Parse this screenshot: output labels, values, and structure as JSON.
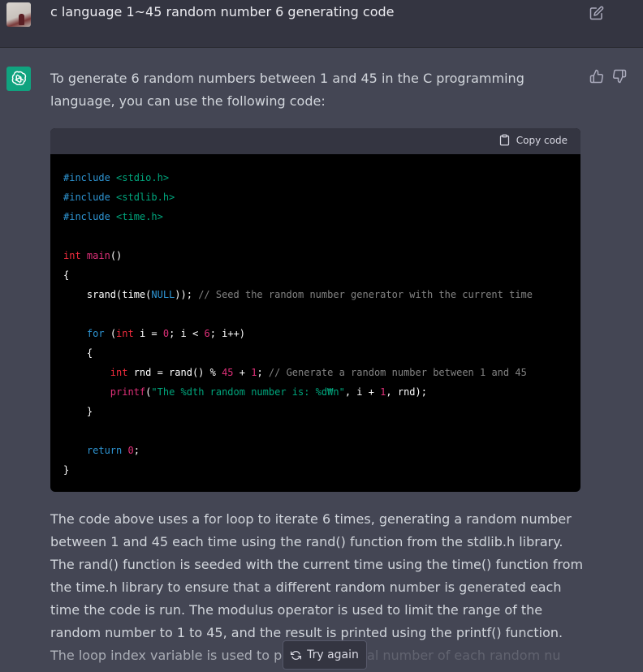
{
  "user_message": {
    "text": "c language 1~45 random number 6 generating code"
  },
  "assistant_message": {
    "intro": "To generate 6 random numbers between 1 and 45 in the C programming language, you can use the following code:",
    "copy_label": "Copy code",
    "outro": "The code above uses a for loop to iterate 6 times, generating a random number between 1 and 45 each time using the rand() function from the stdlib.h library. The rand() function is seeded with the current time using the time() function from the time.h library to ensure that a different random number is generated each time the code is run. The modulus operator is used to limit the range of the random number to 1 to 45, and the result is printed using the printf() function. The loop index variable is used to print",
    "outro_fade": "the ordinal number of each random nu"
  },
  "code": [
    [
      {
        "t": "#include ",
        "c": "cm2"
      },
      {
        "t": "<stdio.h>",
        "c": "str"
      }
    ],
    [
      {
        "t": "#include ",
        "c": "cm2"
      },
      {
        "t": "<stdlib.h>",
        "c": "str"
      }
    ],
    [
      {
        "t": "#include ",
        "c": "cm2"
      },
      {
        "t": "<time.h>",
        "c": "str"
      }
    ],
    [],
    [
      {
        "t": "int",
        "c": "ty"
      },
      {
        "t": " "
      },
      {
        "t": "main",
        "c": "fn"
      },
      {
        "t": "()"
      }
    ],
    [
      {
        "t": "{"
      }
    ],
    [
      {
        "t": "    srand(time("
      },
      {
        "t": "NULL",
        "c": "kw"
      },
      {
        "t": ")); "
      },
      {
        "t": "// Seed the random number generator with the current time",
        "c": "cm"
      }
    ],
    [],
    [
      {
        "t": "    "
      },
      {
        "t": "for",
        "c": "kw"
      },
      {
        "t": " ("
      },
      {
        "t": "int",
        "c": "ty"
      },
      {
        "t": " i = "
      },
      {
        "t": "0",
        "c": "num"
      },
      {
        "t": "; i < "
      },
      {
        "t": "6",
        "c": "num"
      },
      {
        "t": "; i++)"
      }
    ],
    [
      {
        "t": "    {"
      }
    ],
    [
      {
        "t": "        "
      },
      {
        "t": "int",
        "c": "ty"
      },
      {
        "t": " rnd = rand() % "
      },
      {
        "t": "45",
        "c": "num"
      },
      {
        "t": " + "
      },
      {
        "t": "1",
        "c": "num"
      },
      {
        "t": "; "
      },
      {
        "t": "// Generate a random number between 1 and 45",
        "c": "cm"
      }
    ],
    [
      {
        "t": "        "
      },
      {
        "t": "printf",
        "c": "fn"
      },
      {
        "t": "("
      },
      {
        "t": "\"The %dth random number is: %d₩n\"",
        "c": "str"
      },
      {
        "t": ", i + "
      },
      {
        "t": "1",
        "c": "num"
      },
      {
        "t": ", rnd);"
      }
    ],
    [
      {
        "t": "    }"
      }
    ],
    [],
    [
      {
        "t": "    "
      },
      {
        "t": "return",
        "c": "kw"
      },
      {
        "t": " "
      },
      {
        "t": "0",
        "c": "num"
      },
      {
        "t": ";"
      }
    ],
    [
      {
        "t": "}"
      }
    ]
  ],
  "actions": {
    "try_again_label": "Try again"
  },
  "colors": {
    "background": "#444654",
    "user_row": "#343541",
    "accent": "#10a37f",
    "code_bg": "#000000"
  },
  "icons": [
    "edit-icon",
    "thumbs-up-icon",
    "thumbs-down-icon",
    "clipboard-icon",
    "refresh-icon",
    "openai-logo-icon"
  ]
}
